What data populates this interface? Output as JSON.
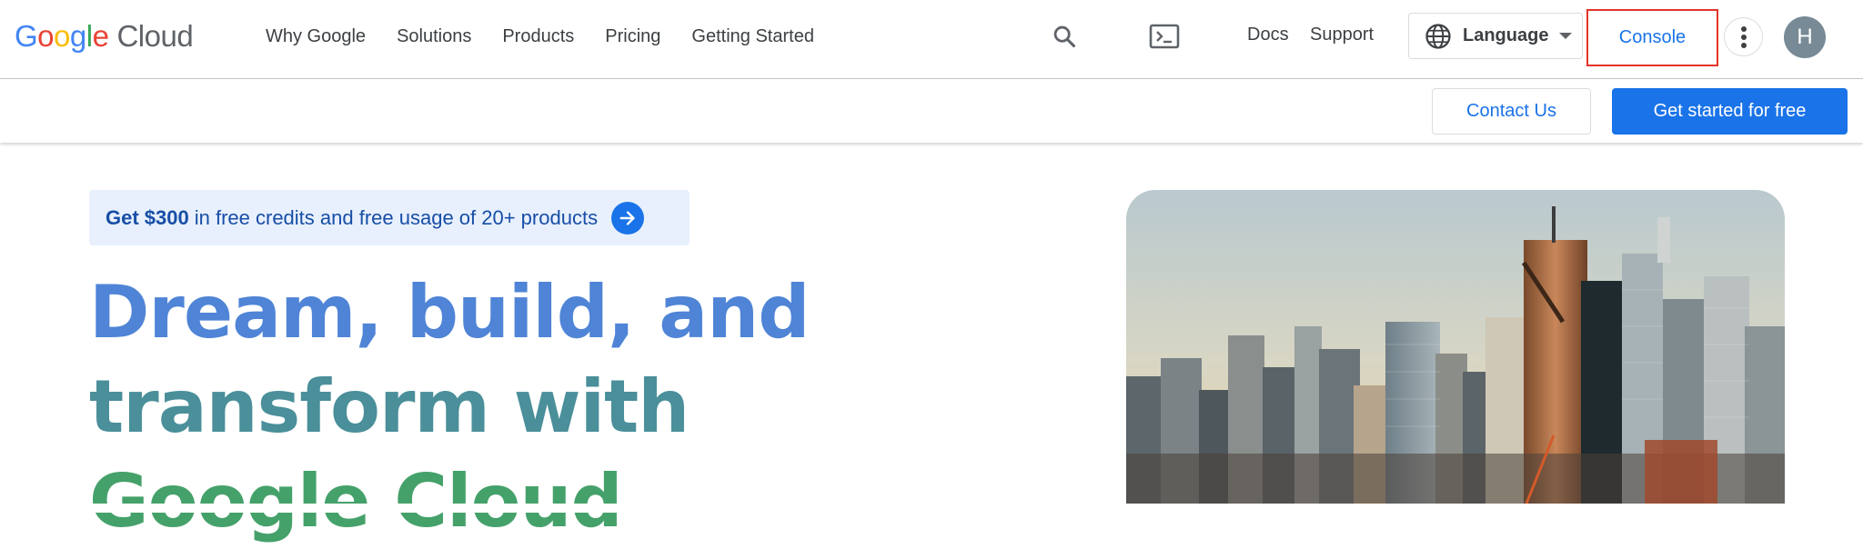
{
  "header": {
    "logo": {
      "google": "Google",
      "cloud": "Cloud"
    },
    "nav": [
      {
        "label": "Why Google"
      },
      {
        "label": "Solutions"
      },
      {
        "label": "Products"
      },
      {
        "label": "Pricing"
      },
      {
        "label": "Getting Started"
      }
    ],
    "icons": {
      "search": "search-icon",
      "terminal": "terminal-icon",
      "more": "more-vert-icon",
      "language": "globe-icon"
    },
    "docs": "Docs",
    "support": "Support",
    "language": {
      "label": "Language"
    },
    "console": "Console",
    "avatar_initial": "H"
  },
  "subbar": {
    "contact": "Contact Us",
    "get_started": "Get started for free"
  },
  "hero": {
    "promo": {
      "bold": "Get $300",
      "rest": "in free credits and free usage of 20+ products"
    },
    "headline": {
      "line1": "Dream, build, and",
      "line2": "transform with",
      "line3": "Google Cloud"
    },
    "image": "city-skyline-image"
  },
  "colors": {
    "accent_blue": "#1a73e8",
    "highlight_red": "#e5332a",
    "headline_blue": "#4f84d6",
    "headline_teal": "#4a8f9a",
    "headline_green": "#45a16a",
    "promo_bg": "#e8f0fe",
    "avatar_bg": "#778a96"
  }
}
